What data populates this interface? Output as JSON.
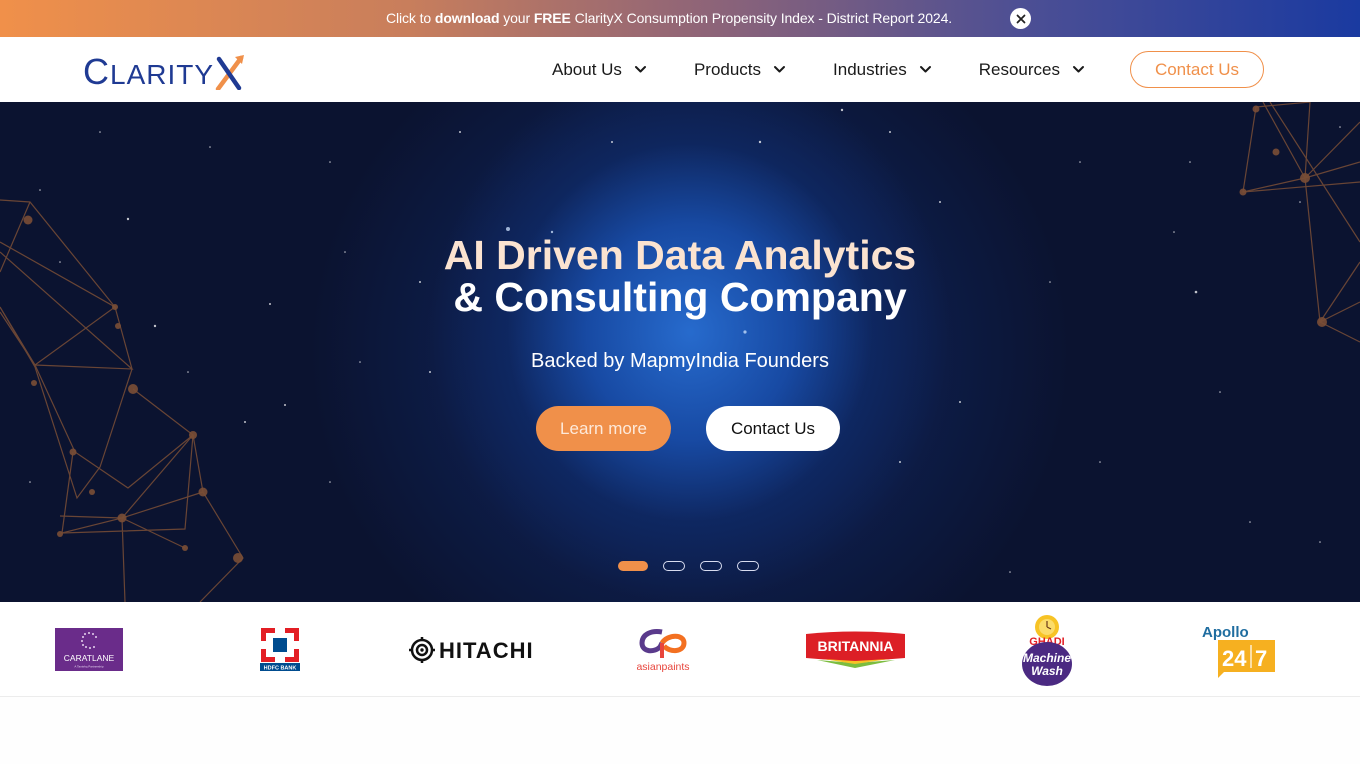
{
  "announcement": {
    "prefix": "Click to ",
    "bold1": "download",
    "middle": " your ",
    "bold2": "FREE",
    "suffix": " ClarityX Consumption Propensity Index - District Report 2024.",
    "close_icon": "close-icon"
  },
  "header": {
    "logo": {
      "first": "C",
      "rest": "LARITY",
      "last": "X"
    },
    "nav": [
      {
        "label": "About Us",
        "icon": "chevron-down-icon"
      },
      {
        "label": "Products",
        "icon": "chevron-down-icon"
      },
      {
        "label": "Industries",
        "icon": "chevron-down-icon"
      },
      {
        "label": "Resources",
        "icon": "chevron-down-icon"
      }
    ],
    "contact_label": "Contact Us"
  },
  "hero": {
    "title_line1": "AI Driven Data Analytics",
    "title_line2": "& Consulting Company",
    "subtitle": "Backed by MapmyIndia Founders",
    "learn_more_label": "Learn more",
    "contact_label": "Contact Us",
    "slides": {
      "count": 4,
      "active": 1
    }
  },
  "clients": [
    {
      "name": "CaratLane",
      "text": "CARATLANE",
      "tagline": "A Tanishq Partnership"
    },
    {
      "name": "HDFC Bank",
      "text": "HDFC BANK"
    },
    {
      "name": "Hitachi",
      "text": "HITACHI"
    },
    {
      "name": "Asian Paints",
      "text": "asianpaints"
    },
    {
      "name": "Britannia",
      "text": "BRITANNIA"
    },
    {
      "name": "Ghadi Machine Wash",
      "text1": "GHADI",
      "text2": "Machine",
      "text3": "Wash"
    },
    {
      "name": "Apollo 24/7",
      "text1": "Apollo",
      "text2": "24",
      "text3": "7"
    }
  ],
  "colors": {
    "accent_orange": "#f0904a",
    "brand_blue": "#1f3a93",
    "hero_bg": "#0b1330"
  }
}
